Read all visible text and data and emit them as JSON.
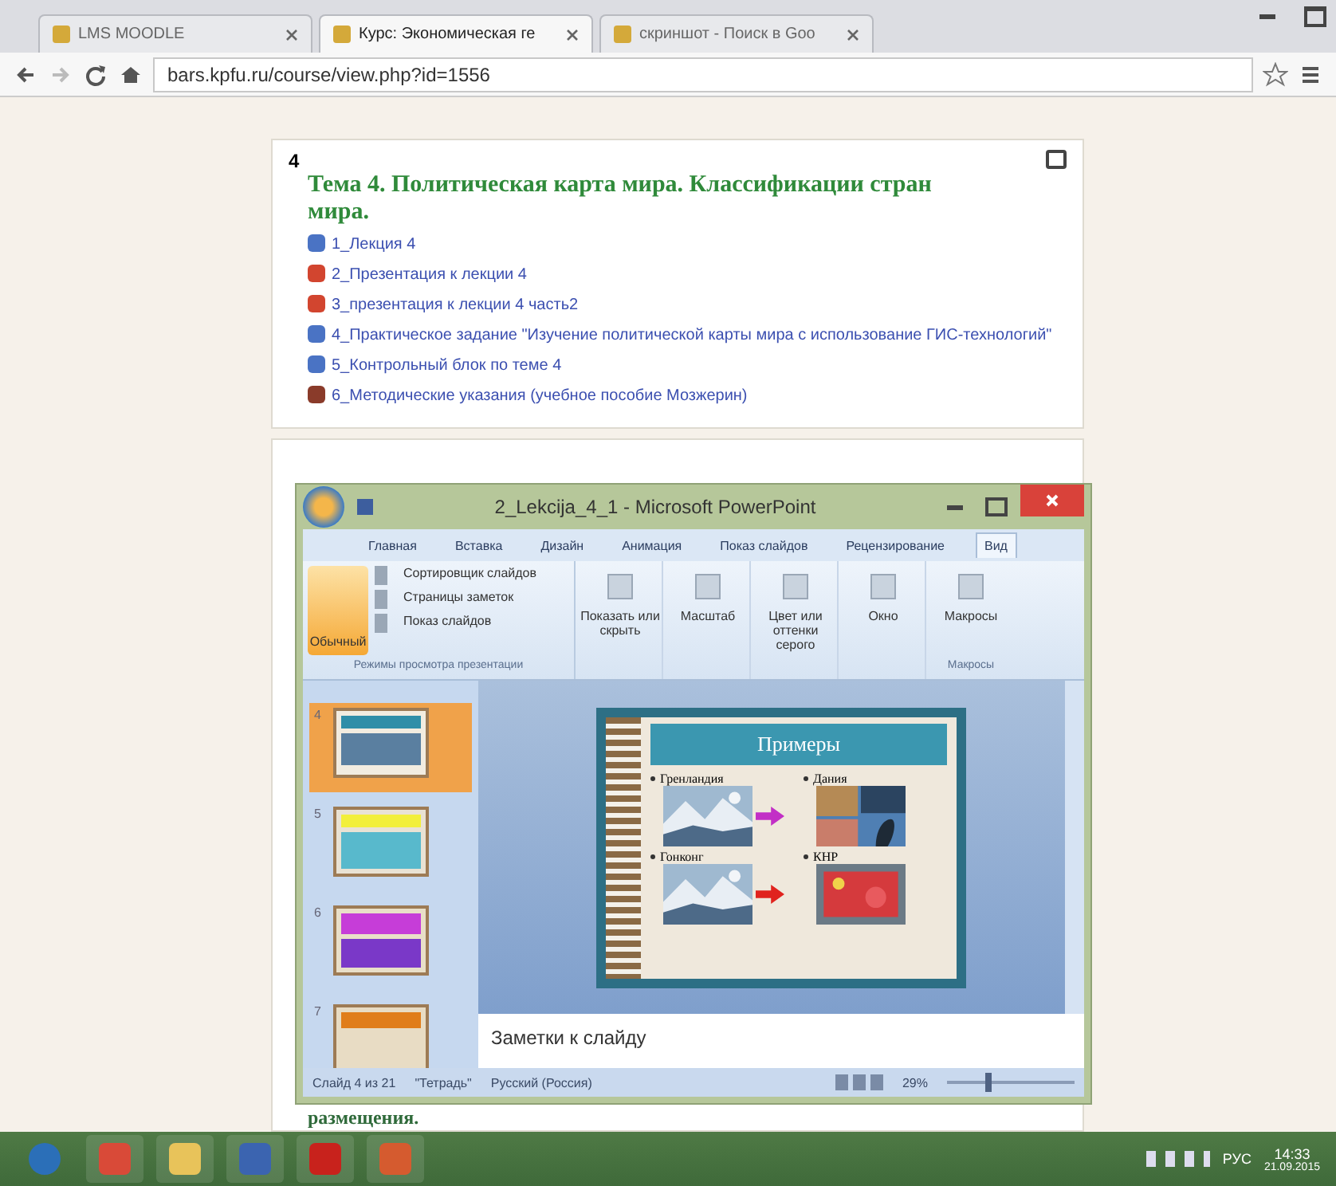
{
  "browser": {
    "tabs": [
      {
        "label": "LMS MOODLE",
        "selected": false
      },
      {
        "label": "Курс: Экономическая ге",
        "selected": true
      },
      {
        "label": "скриншот - Поиск в Goo",
        "selected": false
      }
    ],
    "address": "bars.kpfu.ru/course/view.php?id=1556"
  },
  "section": {
    "number": "4",
    "title": "Тема 4. Политическая карта мира. Классификации стран мира.",
    "items": [
      {
        "label": "1_Лекция 4",
        "kind": "doc"
      },
      {
        "label": "2_Презентация к лекции 4",
        "kind": "ppt"
      },
      {
        "label": "3_презентация к лекции 4 часть2",
        "kind": "ppt"
      },
      {
        "label": "4_Практическое задание \"Изучение политической карты мира с использование ГИС-технологий\"",
        "kind": "doc"
      },
      {
        "label": "5_Контрольный блок по теме 4",
        "kind": "doc"
      },
      {
        "label": "6_Методические указания (учебное пособие Мозжерин)",
        "kind": "book"
      }
    ]
  },
  "next_section": {
    "title_fragment": "размещения."
  },
  "powerpoint": {
    "title": "2_Lekcija_4_1 - Microsoft PowerPoint",
    "ribbon_tabs": [
      {
        "label": "Главная",
        "selected": false
      },
      {
        "label": "Вставка",
        "selected": false
      },
      {
        "label": "Дизайн",
        "selected": false
      },
      {
        "label": "Анимация",
        "selected": false
      },
      {
        "label": "Показ слайдов",
        "selected": false
      },
      {
        "label": "Рецензирование",
        "selected": false
      },
      {
        "label": "Вид",
        "selected": true
      }
    ],
    "view_modes": [
      {
        "label": "Обычный",
        "selected": true
      },
      {
        "label": "Сортировщик слайдов",
        "selected": false
      },
      {
        "label": "Страницы заметок",
        "selected": false
      },
      {
        "label": "Показ слайдов",
        "selected": false
      }
    ],
    "view_group_label": "Режимы просмотра презентации",
    "commands": [
      {
        "label": "Показать или скрыть"
      },
      {
        "label": "Масштаб"
      },
      {
        "label": "Цвет или оттенки серого"
      },
      {
        "label": "Окно"
      },
      {
        "label": "Макросы"
      }
    ],
    "macros_group_label": "Макросы",
    "thumbnails": [
      {
        "number": "4",
        "selected": true,
        "kind": "photos"
      },
      {
        "number": "5",
        "selected": false,
        "kind": "text"
      },
      {
        "number": "6",
        "selected": false,
        "kind": "purple"
      },
      {
        "number": "7",
        "selected": false,
        "kind": "orange"
      }
    ],
    "slide": {
      "title": "Примеры",
      "captions": [
        "Гренландия",
        "Дания",
        "Гонконг",
        "КНР"
      ]
    },
    "notes_placeholder": "Заметки к слайду",
    "status": [
      "Слайд 4 из 21",
      "\"Тетрадь\"",
      "Русский (Россия)"
    ],
    "zoom": "29%",
    "zoom_slider": {
      "level": 0.3
    }
  },
  "taskbar": {
    "apps": [
      {
        "kind": "start"
      },
      {
        "kind": "chrome"
      },
      {
        "kind": "explorer"
      },
      {
        "kind": "word"
      },
      {
        "kind": "pdf"
      },
      {
        "kind": "powerpoint"
      }
    ],
    "language": "РУС",
    "time": "14:33",
    "date": "21.09.2015"
  }
}
